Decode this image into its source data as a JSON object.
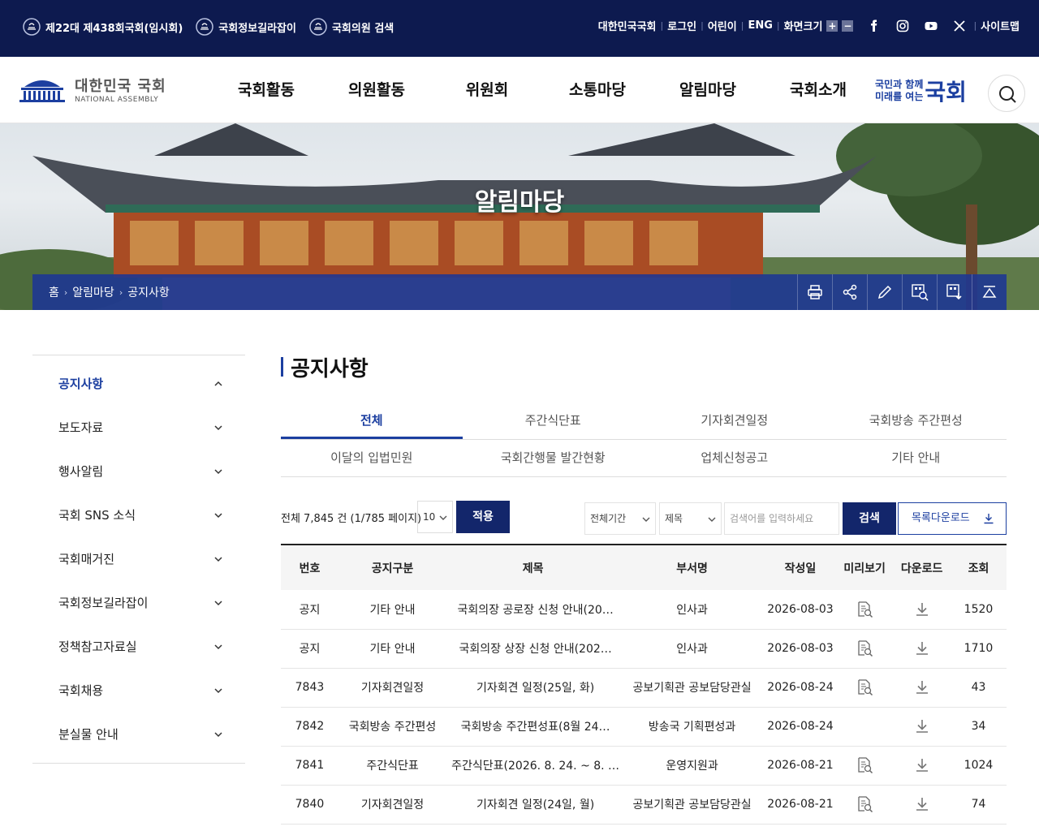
{
  "utility": {
    "left_links": [
      "제22대 제438회국회(임시회)",
      "국회정보길라잡이",
      "국회의원 검색"
    ],
    "right_links": [
      "대한민국국회",
      "로그인",
      "어린이",
      "ENG",
      "화면크기"
    ],
    "font_plus": "+",
    "font_minus": "−",
    "sitemap": "사이트맵",
    "socials": [
      "facebook-icon",
      "instagram-icon",
      "youtube-icon",
      "x-icon"
    ]
  },
  "header": {
    "logo_title": "대한민국 국회",
    "logo_sub": "NATIONAL ASSEMBLY",
    "nav": [
      "국회활동",
      "의원활동",
      "위원회",
      "소통마당",
      "알림마당",
      "국회소개"
    ],
    "slogan_line1": "국민과 함께",
    "slogan_line2": "미래를 여는",
    "slogan_big": "국회"
  },
  "visual": {
    "title": "알림마당",
    "breadcrumb": [
      "홈",
      "알림마당",
      "공지사항"
    ],
    "tools": [
      "print-icon",
      "share-icon",
      "edit-icon",
      "qr-search-icon",
      "qr-download-icon",
      "top-icon"
    ]
  },
  "sidebar": {
    "items": [
      "공지사항",
      "보도자료",
      "행사알림",
      "국회 SNS 소식",
      "국회매거진",
      "국회정보길라잡이",
      "정책참고자료실",
      "국회채용",
      "분실물 안내"
    ]
  },
  "content": {
    "title": "공지사항",
    "tabs_row1": [
      "전체",
      "주간식단표",
      "기자회견일정",
      "국회방송 주간편성"
    ],
    "tabs_row2": [
      "이달의 입법민원",
      "국회간행물 발간현황",
      "업체신청공고",
      "기타 안내"
    ],
    "total": "전체 7,845 건 (1/785 페이지)",
    "per_page": "10",
    "apply": "적용",
    "period": "전체기간",
    "field": "제목",
    "search_placeholder": "검색어를 입력하세요",
    "search": "검색",
    "download_list": "목록다운로드"
  },
  "table": {
    "headers": [
      "번호",
      "공지구분",
      "제목",
      "부서명",
      "작성일",
      "미리보기",
      "다운로드",
      "조회"
    ],
    "rows": [
      {
        "no": "공지",
        "cat": "기타 안내",
        "title": "국회의장 공로장 신청 안내(20…",
        "dept": "인사과",
        "date": "2026-08-03",
        "preview": true,
        "views": "1520"
      },
      {
        "no": "공지",
        "cat": "기타 안내",
        "title": "국회의장 상장 신청 안내(202…",
        "dept": "인사과",
        "date": "2026-08-03",
        "preview": true,
        "views": "1710"
      },
      {
        "no": "7843",
        "cat": "기자회견일정",
        "title": "기자회견 일정(25일, 화)",
        "dept": "공보기획관 공보담당관실",
        "date": "2026-08-24",
        "preview": true,
        "views": "43"
      },
      {
        "no": "7842",
        "cat": "국회방송 주간편성",
        "title": "국회방송 주간편성표(8월 24…",
        "dept": "방송국 기획편성과",
        "date": "2026-08-24",
        "preview": false,
        "views": "34"
      },
      {
        "no": "7841",
        "cat": "주간식단표",
        "title": "주간식단표(2026. 8. 24. ~ 8. …",
        "dept": "운영지원과",
        "date": "2026-08-21",
        "preview": true,
        "views": "1024"
      },
      {
        "no": "7840",
        "cat": "기자회견일정",
        "title": "기자회견 일정(24일, 월)",
        "dept": "공보기획관 공보담당관실",
        "date": "2026-08-21",
        "preview": true,
        "views": "74"
      }
    ]
  }
}
